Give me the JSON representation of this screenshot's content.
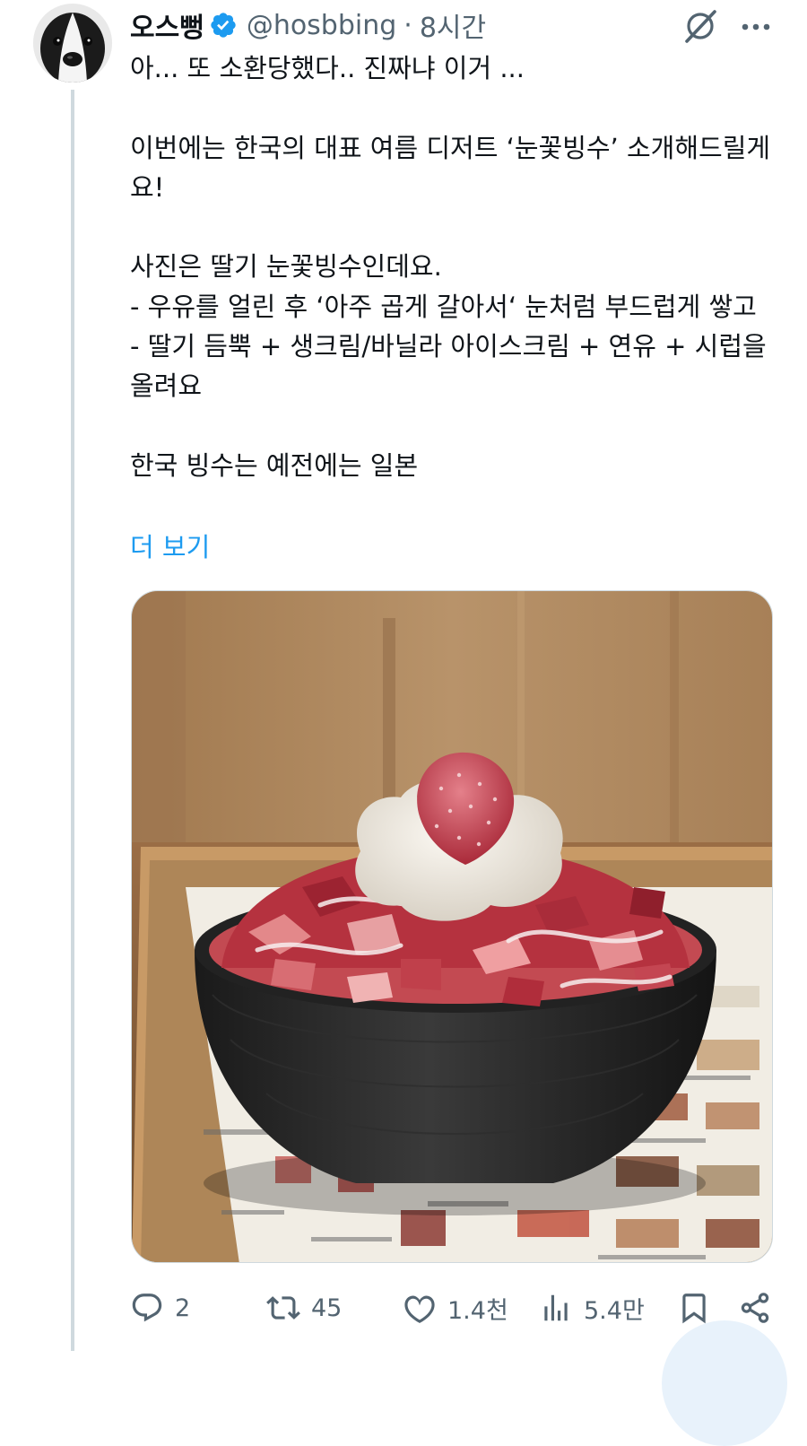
{
  "tweet": {
    "author": {
      "display_name": "오스뻥",
      "handle": "@hosbbing",
      "time": "8시간",
      "separator": "·"
    },
    "text": "아... 또 소환당했다.. 진짜냐 이거 ...\n\n이번에는 한국의 대표 여름 디저트 ‘눈꽃빙수’ 소개해드릴게요!\n\n사진은 딸기 눈꽃빙수인데요.\n- 우유를 얼린 후 ‘아주 곱게 갈아서‘ 눈처럼 부드럽게 쌓고\n- 딸기 듬뿍 + 생크림/바닐라 아이스크림 + 연유 + 시럽을 올려요\n\n한국 빙수는 예전에는 일본",
    "show_more": "더 보기",
    "icons": [
      "verified-badge-icon",
      "grok-icon",
      "more-icon"
    ],
    "media": {
      "subject": "strawberry-snowflake-bingsu-photo"
    },
    "actions": {
      "reply_count": "2",
      "retweet_count": "45",
      "like_count": "1.4천",
      "view_count": "5.4만",
      "icons": [
        "reply-icon",
        "retweet-icon",
        "like-icon",
        "views-icon",
        "bookmark-icon",
        "share-icon"
      ]
    },
    "colors": {
      "text": "#0f1419",
      "secondary": "#536471",
      "link": "#1d9bf0",
      "verified": "#1d9bf0",
      "thread_line": "#cfd9de"
    }
  }
}
